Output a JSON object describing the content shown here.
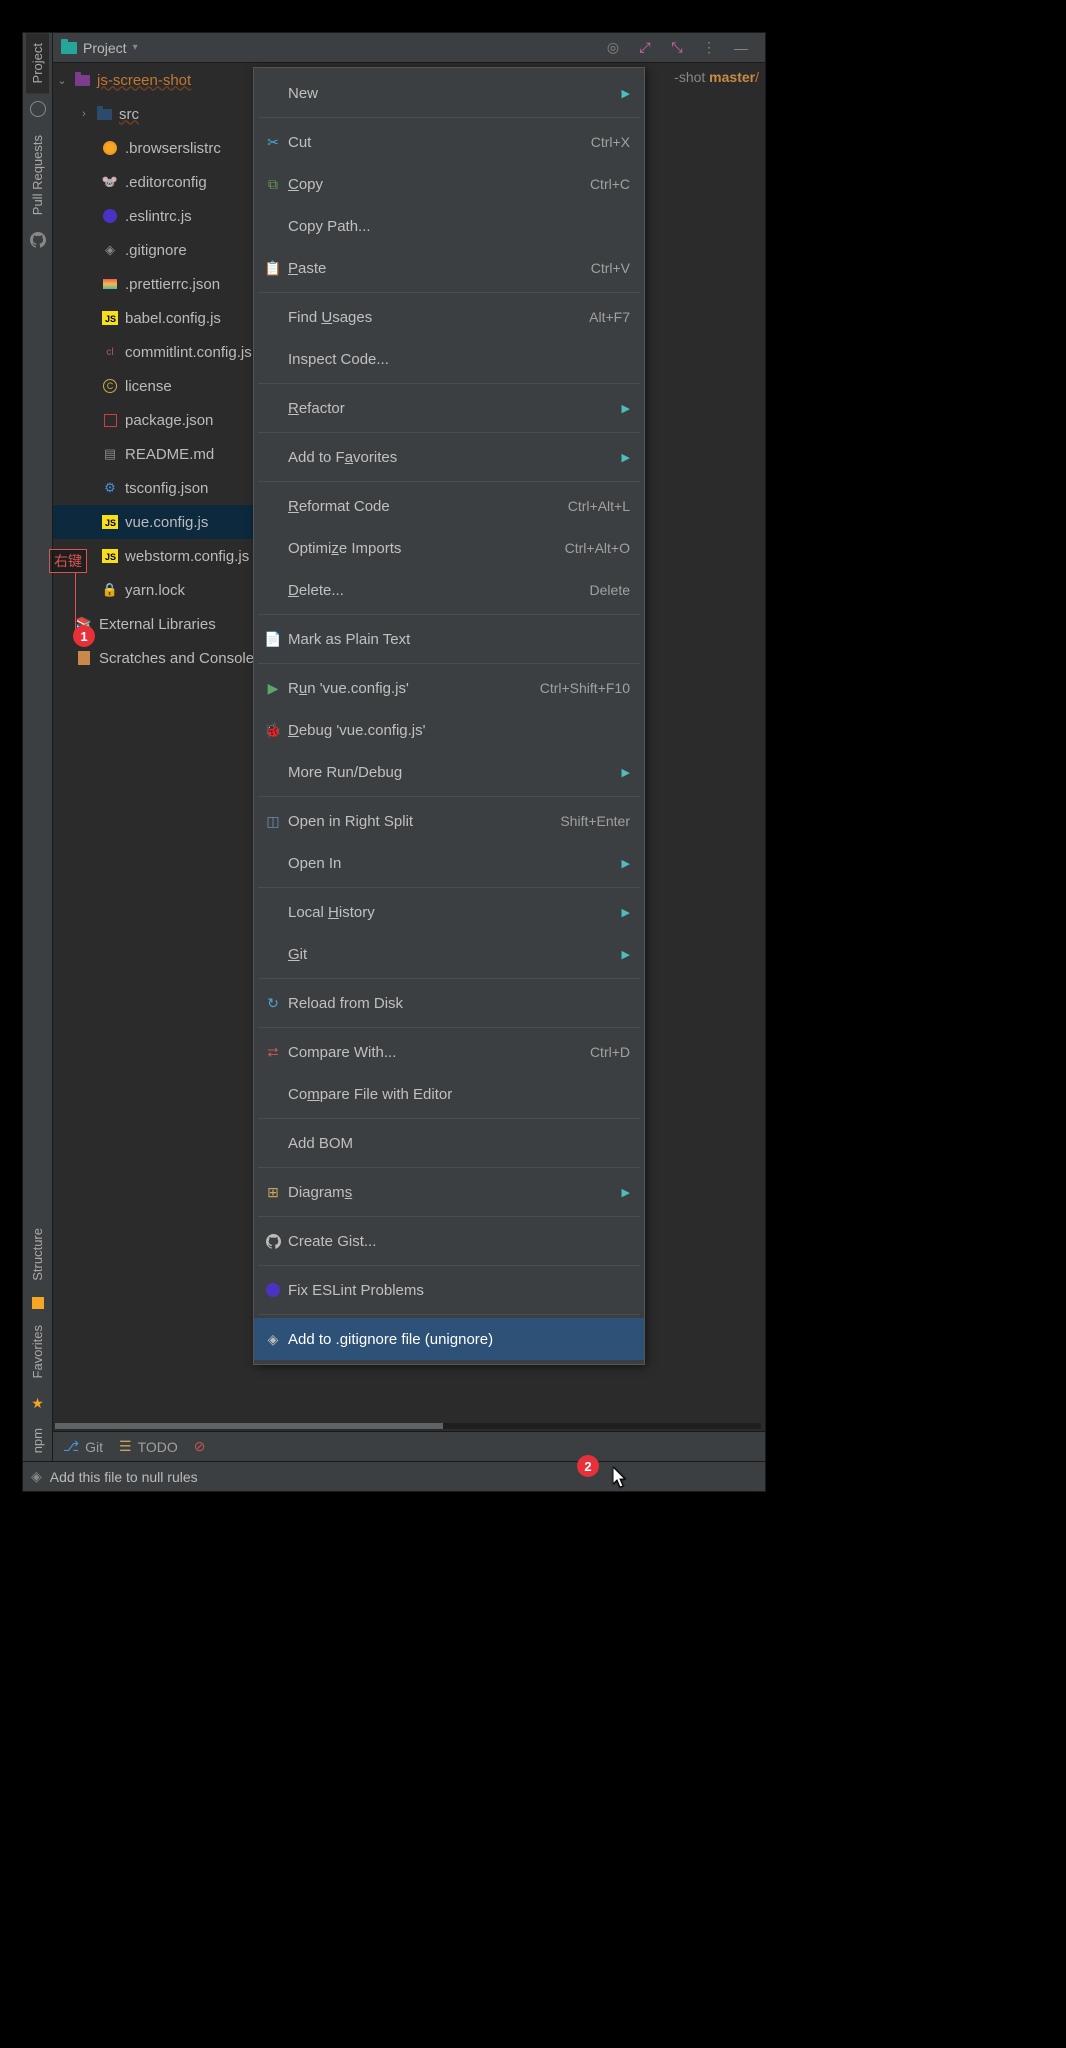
{
  "topBar": {
    "projectLabel": "Project"
  },
  "breadcrumb": {
    "shot": "-shot",
    "branch": " master",
    "slash": "/"
  },
  "leftToolbar": {
    "projectTab": "Project",
    "pullRequestsTab": "Pull Requests",
    "structureTab": "Structure",
    "favoritesTab": "Favorites",
    "npmTab": "npm"
  },
  "tree": {
    "root": "js-screen-shot",
    "src": "src",
    "files": {
      "browserslist": ".browserslistrc",
      "editorconfig": ".editorconfig",
      "eslintrc": ".eslintrc.js",
      "gitignore": ".gitignore",
      "prettierrc": ".prettierrc.json",
      "babelconfig": "babel.config.js",
      "commitlint": "commitlint.config.js",
      "license": "license",
      "packagejson": "package.json",
      "readme": "README.md",
      "tsconfig": "tsconfig.json",
      "vueconfig": "vue.config.js",
      "webstormconfig": "webstorm.config.js",
      "yarnlock": "yarn.lock"
    },
    "external": "External Libraries",
    "scratches": "Scratches and Consoles"
  },
  "annotation": {
    "rightClick": "右键",
    "badge1": "1",
    "badge2": "2"
  },
  "contextMenu": {
    "new": "New",
    "cut": "Cut",
    "cutKey": "Ctrl+X",
    "copy": "Copy",
    "copyKey": "Ctrl+C",
    "copyPath": "Copy Path...",
    "paste": "Paste",
    "pasteKey": "Ctrl+V",
    "findUsages": "Find Usages",
    "findUsagesKey": "Alt+F7",
    "inspectCode": "Inspect Code...",
    "refactor": "Refactor",
    "addFavorites": "Add to Favorites",
    "reformatCode": "Reformat Code",
    "reformatCodeKey": "Ctrl+Alt+L",
    "optimizeImports": "Optimize Imports",
    "optimizeImportsKey": "Ctrl+Alt+O",
    "delete": "Delete...",
    "deleteKey": "Delete",
    "markPlain": "Mark as Plain Text",
    "run": "Run 'vue.config.js'",
    "runKey": "Ctrl+Shift+F10",
    "debug": "Debug 'vue.config.js'",
    "moreRun": "More Run/Debug",
    "openSplit": "Open in Right Split",
    "openSplitKey": "Shift+Enter",
    "openIn": "Open In",
    "localHistory": "Local History",
    "git": "Git",
    "reloadDisk": "Reload from Disk",
    "compareWith": "Compare With...",
    "compareWithKey": "Ctrl+D",
    "compareEditor": "Compare File with Editor",
    "addBom": "Add BOM",
    "diagrams": "Diagrams",
    "createGist": "Create Gist...",
    "fixEslint": "Fix ESLint Problems",
    "addGitignore": "Add to .gitignore file (unignore)"
  },
  "bottomBar": {
    "git": "Git",
    "todo": "TODO"
  },
  "statusBar": {
    "message": "Add this file to null rules"
  }
}
